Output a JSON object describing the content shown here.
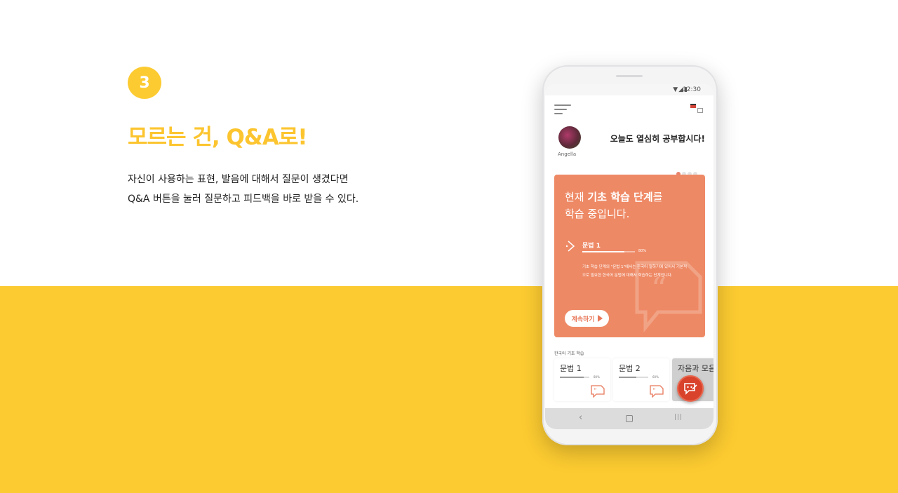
{
  "step": {
    "number": "3"
  },
  "headline": "모르는 건, Q&A로!",
  "description": {
    "line1": "자신이 사용하는 표현, 발음에 대해서 질문이 생겼다면",
    "line2": "Q&A 버튼을 눌러 질문하고 피드백을 바로 받을 수 있다."
  },
  "colors": {
    "accent": "#fccb31",
    "card": "#ee8965",
    "fab": "#d9422b"
  },
  "phone": {
    "status": {
      "icons": "▼◢▮",
      "time": "12:30"
    },
    "header": {
      "menu_icon": "hamburger-menu-icon",
      "language_icon": "language-switch-icon"
    },
    "user": {
      "name": "Angella",
      "greeting": "오늘도 열심히 공부합시다!"
    },
    "carousel": {
      "pages": 4,
      "active": 1
    },
    "card": {
      "heading_prefix": "현재 ",
      "heading_bold": "기초 학습 단계",
      "heading_suffix": "를",
      "heading_line2": "학습 중입니다.",
      "lesson_title": "문법 1",
      "progress": 0.8,
      "progress_label": "80%",
      "lesson_desc": "기초 학습 단계의 \"문법 1\"에서는 한국어 말하기에 있어서 기본적으로 필요한 한국어 문법에 대해서 학습하는 단계입니다.",
      "continue_label": "계속하기"
    },
    "section_label": "한국어 기초 학습",
    "lessons": [
      {
        "title": "문법 1",
        "progress": 0.8,
        "progress_label": "80%"
      },
      {
        "title": "문법 2",
        "progress": 0.6,
        "progress_label": "60%"
      },
      {
        "title": "자음과 모음"
      }
    ],
    "fab_icon": "qa-chat-icon",
    "nav": {
      "back": "‹",
      "recent": "|||"
    }
  }
}
